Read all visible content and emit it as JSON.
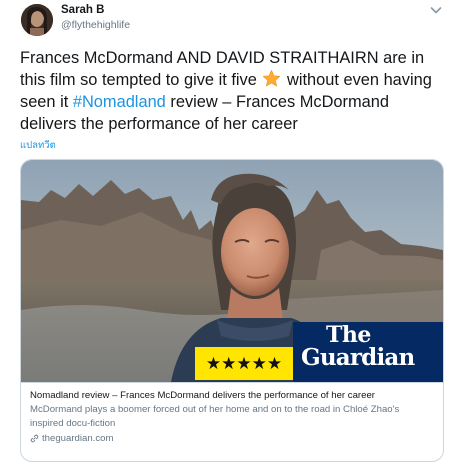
{
  "user": {
    "display_name": "Sarah B",
    "handle": "@flythehighlife",
    "avatar_icon": "profile-photo"
  },
  "tweet": {
    "text_before_star": "Frances McDormand AND DAVID STRAITHAIRN are in this film so tempted to give it five",
    "star_icon": "star-emoji",
    "text_after_star": "without even having seen it",
    "hashtag": "#Nomadland",
    "text_after_hashtag": "review – Frances McDormand delivers the performance of her career",
    "translate_label": "แปลทวีต"
  },
  "card": {
    "image_brand_the": "The",
    "image_brand_name": "Guardian",
    "rating_stars": [
      "★",
      "★",
      "★",
      "★",
      "★"
    ],
    "rating_value": 5,
    "title": "Nomadland review – Frances McDormand delivers the performance of her career",
    "description": "McDormand plays a boomer forced out of her home and on to the road in Chloé Zhao's inspired docu-fiction",
    "domain": "theguardian.com",
    "domain_icon": "link-icon"
  },
  "colors": {
    "link": "#1b95e0",
    "guardian_blue": "#052962",
    "rating_yellow": "#ffe500",
    "secondary_text": "#657786"
  }
}
